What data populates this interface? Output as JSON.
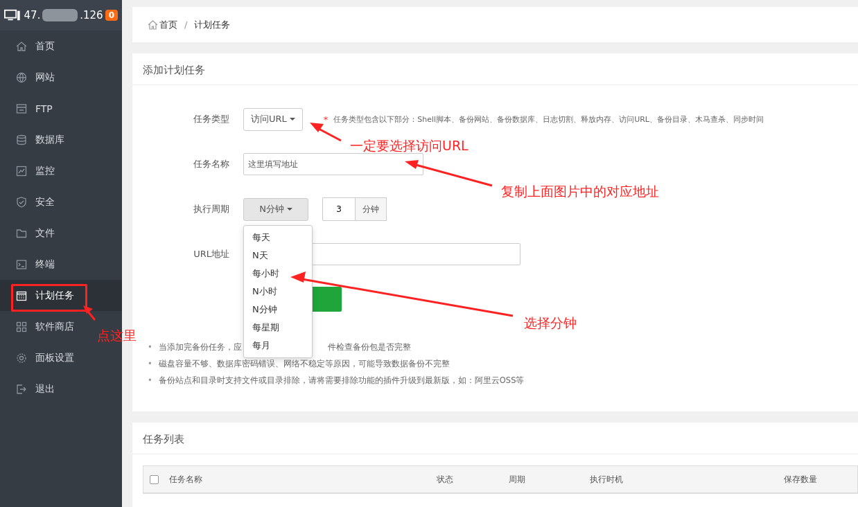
{
  "sidebar": {
    "host_prefix": "47.",
    "host_suffix": ".126",
    "badge": "0",
    "items": [
      {
        "label": "首页",
        "selected": false
      },
      {
        "label": "网站",
        "selected": false
      },
      {
        "label": "FTP",
        "selected": false
      },
      {
        "label": "数据库",
        "selected": false
      },
      {
        "label": "监控",
        "selected": false
      },
      {
        "label": "安全",
        "selected": false
      },
      {
        "label": "文件",
        "selected": false
      },
      {
        "label": "终端",
        "selected": false
      },
      {
        "label": "计划任务",
        "selected": true
      },
      {
        "label": "软件商店",
        "selected": false
      },
      {
        "label": "面板设置",
        "selected": false
      },
      {
        "label": "退出",
        "selected": false
      }
    ]
  },
  "breadcrumb": [
    "首页",
    "计划任务"
  ],
  "breadcrumb_separator": "/",
  "form": {
    "title": "添加计划任务",
    "task_type": {
      "label": "任务类型",
      "value": "访问URL",
      "required_mark": "*",
      "hint": "任务类型包含以下部分：Shell脚本、备份网站、备份数据库、日志切割、释放内存、访问URL、备份目录、木马查杀、同步时间"
    },
    "task_name": {
      "label": "任务名称",
      "value": "这里填写地址"
    },
    "period": {
      "label": "执行周期",
      "value": "N分钟",
      "number": "3",
      "unit": "分钟",
      "options": [
        "每天",
        "N天",
        "每小时",
        "N小时",
        "N分钟",
        "每星期",
        "每月"
      ]
    },
    "url": {
      "label": "URL地址"
    },
    "note_marker": "•",
    "notes": [
      "当添加完备份任务，应",
      "件检查备份包是否完整",
      "磁盘容量不够、数据库密码错误、网络不稳定等原因，可能导致数据备份不完整",
      "备份站点和目录时支持文件或目录排除，请将需要排除功能的插件升级到最新版，如：阿里云OSS等"
    ]
  },
  "task_list": {
    "title": "任务列表",
    "select_all_checked": false,
    "columns": [
      "任务名称",
      "状态",
      "周期",
      "执行时机",
      "保存数量"
    ]
  },
  "annotations": [
    "一定要选择访问URL",
    "复制上面图片中的对应地址",
    "选择分钟",
    "点这里"
  ]
}
